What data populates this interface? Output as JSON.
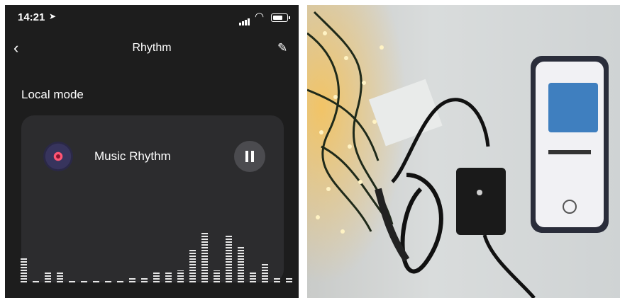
{
  "status_bar": {
    "time": "14:21"
  },
  "header": {
    "title": "Rhythm"
  },
  "section": {
    "title": "Local mode"
  },
  "card": {
    "mode_label": "Music Rhythm",
    "playing": true
  },
  "equalizer_levels": [
    0.42,
    0,
    0.19,
    0.19,
    0,
    0.02,
    0,
    0,
    0,
    0.08,
    0.08,
    0.19,
    0.19,
    0.21,
    0.58,
    0.88,
    0.21,
    0.85,
    0.62,
    0.19,
    0.33,
    0.08,
    0.1
  ],
  "photo": {
    "alt": "string lights with controller and phone playing music"
  },
  "colors": {
    "app_background": "#1d1d1d",
    "card_background": "#2c2c2e",
    "accent": "#ff5574"
  }
}
